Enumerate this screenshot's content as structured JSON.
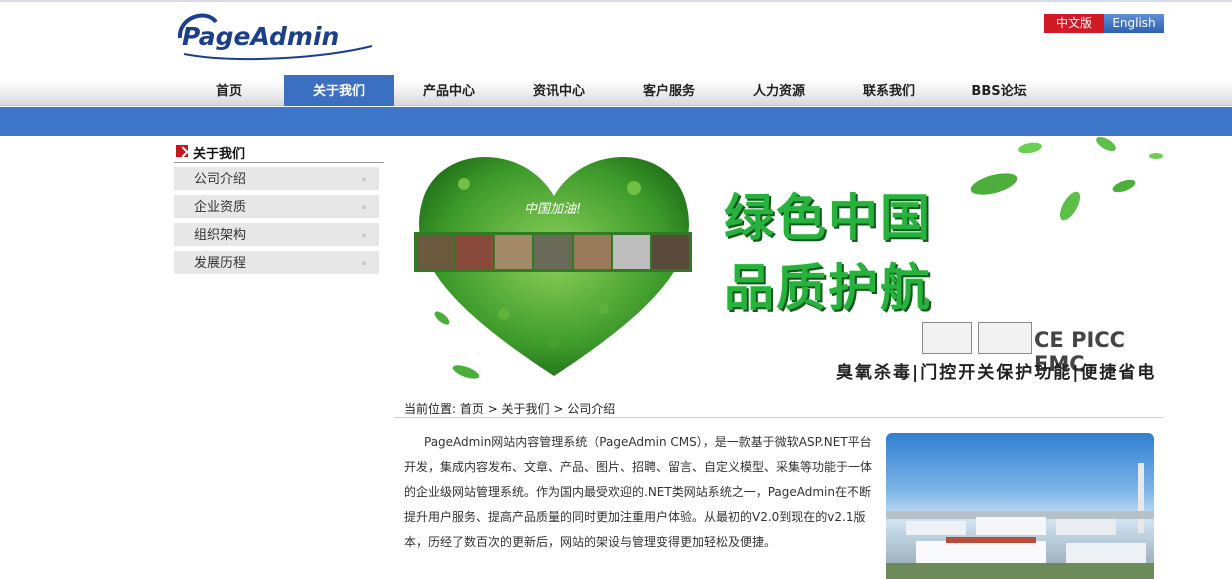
{
  "header": {
    "logo_text": "PageAdmin",
    "lang_cn": "中文版",
    "lang_en": "English"
  },
  "nav": {
    "items": [
      {
        "label": "首页"
      },
      {
        "label": "关于我们",
        "active": true
      },
      {
        "label": "产品中心"
      },
      {
        "label": "资讯中心"
      },
      {
        "label": "客户服务"
      },
      {
        "label": "人力资源"
      },
      {
        "label": "联系我们"
      },
      {
        "label": "BBS论坛"
      }
    ]
  },
  "sidebar": {
    "title": "关于我们",
    "items": [
      {
        "label": "公司介绍"
      },
      {
        "label": "企业资质"
      },
      {
        "label": "组织架构"
      },
      {
        "label": "发展历程"
      }
    ],
    "arrow": "»"
  },
  "banner": {
    "heart_text": "中国加油!",
    "line1": "绿色中国",
    "line2": "品质护航",
    "cert_text": "CE PICC EMC",
    "slogan": "臭氧杀毒|门控开关保护功能|便捷省电"
  },
  "breadcrumb": {
    "text": "当前位置: 首页 > 关于我们 > 公司介绍"
  },
  "article": {
    "body": "PageAdmin网站内容管理系统（PageAdmin CMS），是一款基于微软ASP.NET平台开发，集成内容发布、文章、产品、图片、招聘、留言、自定义模型、采集等功能于一体的企业级网站管理系统。作为国内最受欢迎的.NET类网站系统之一，PageAdmin在不断提升用户服务、提高产品质量的同时更加注重用户体验。从最初的V2.0到现在的v2.1版本，历经了数百次的更新后，网站的架设与管理变得更加轻松及便捷。"
  },
  "colors": {
    "nav_active": "#3b6fc2",
    "blue_band": "#3e77c9",
    "lang_cn": "#d11b24",
    "banner_green": "#27b13d"
  }
}
